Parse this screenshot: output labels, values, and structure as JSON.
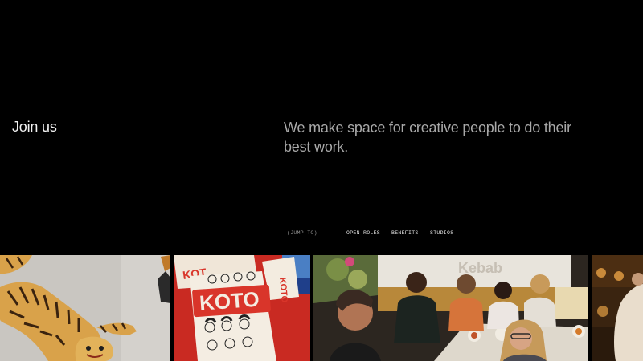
{
  "header": {
    "title": "Join us",
    "tagline": "We make space for creative people to do their best work."
  },
  "jump_nav": {
    "label": "(JUMP TO)",
    "links": [
      "OPEN ROLES",
      "BENEFITS",
      "STUDIOS"
    ]
  },
  "gallery": {
    "photos": [
      {
        "subject": "tiger-rug"
      },
      {
        "subject": "koto-illustrated-poster",
        "sign_text": "KOTO",
        "side_text": "KOTO"
      },
      {
        "subject": "team-dinner",
        "sign_text": "Kebab"
      },
      {
        "subject": "restaurant-interior"
      }
    ]
  },
  "colors": {
    "background": "#000000",
    "title": "#f2f2f2",
    "tagline": "#a8a8a8",
    "nav_link": "#e8e8e8",
    "nav_label": "#8f8f8f",
    "poster_red": "#d9352a"
  }
}
